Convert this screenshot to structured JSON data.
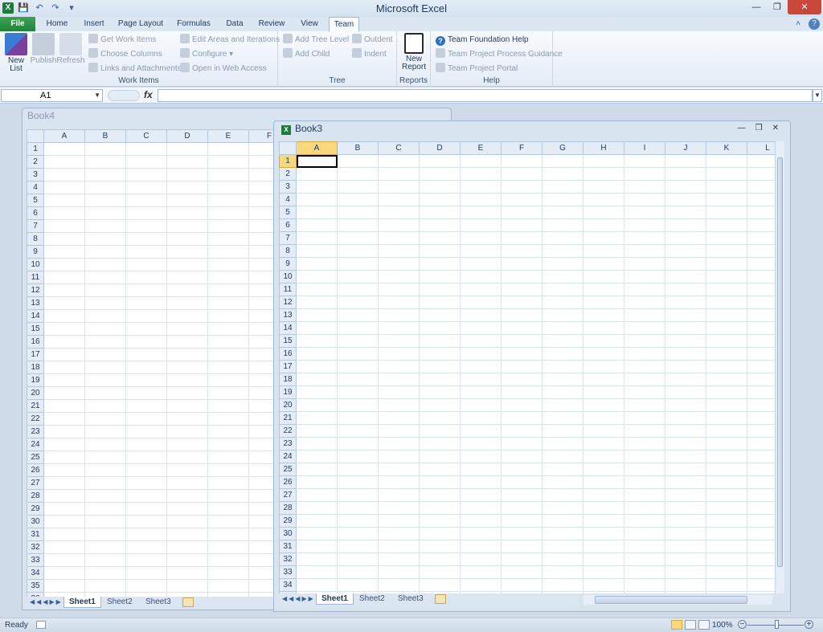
{
  "window": {
    "title": "Microsoft Excel"
  },
  "tabs": [
    "File",
    "Home",
    "Insert",
    "Page Layout",
    "Formulas",
    "Data",
    "Review",
    "View",
    "Team"
  ],
  "active_tab": "Team",
  "ribbon": {
    "new_list": "New List",
    "publish": "Publish",
    "refresh": "Refresh",
    "get_work_items": "Get Work Items",
    "choose_columns": "Choose Columns",
    "links_attachments": "Links and Attachments",
    "edit_areas": "Edit Areas and Iterations",
    "configure": "Configure",
    "open_web_access": "Open in Web Access",
    "work_items_label": "Work Items",
    "add_tree_level": "Add Tree Level",
    "add_child": "Add Child",
    "outdent": "Outdent",
    "indent": "Indent",
    "tree_label": "Tree",
    "new_report": "New Report",
    "reports_label": "Reports",
    "tf_help": "Team Foundation Help",
    "process_guidance": "Team Project Process Guidance",
    "project_portal": "Team Project Portal",
    "help_label": "Help"
  },
  "formula_bar": {
    "name_box": "A1",
    "fx": "fx",
    "formula": ""
  },
  "book4": {
    "title": "Book4",
    "columns": [
      "A",
      "B",
      "C",
      "D",
      "E",
      "F"
    ],
    "row_count": 35,
    "sheets": [
      "Sheet1",
      "Sheet2",
      "Sheet3"
    ],
    "active_sheet": "Sheet1"
  },
  "book3": {
    "title": "Book3",
    "columns": [
      "A",
      "B",
      "C",
      "D",
      "E",
      "F",
      "G",
      "H",
      "I",
      "J",
      "K",
      "L"
    ],
    "row_count": 34,
    "active_cell": "A1",
    "sheets": [
      "Sheet1",
      "Sheet2",
      "Sheet3"
    ],
    "active_sheet": "Sheet1"
  },
  "status": {
    "ready": "Ready",
    "zoom": "100%"
  },
  "icons": {
    "app": "excel-icon",
    "save": "save-icon",
    "undo": "undo-icon",
    "redo": "redo-icon",
    "minimize": "minimize-icon",
    "restore": "restore-icon",
    "close": "close-icon"
  }
}
